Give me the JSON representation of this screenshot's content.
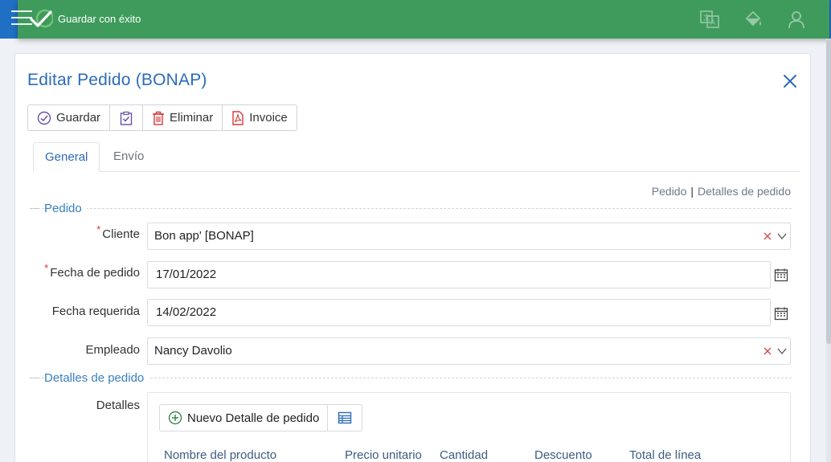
{
  "toast": {
    "message": "Guardar con éxito",
    "icons": [
      "menu-icon",
      "checkmark-icon",
      "translate-icon",
      "paint-bucket-icon",
      "user-icon"
    ]
  },
  "form": {
    "title": "Editar Pedido (BONAP)",
    "toolbar": {
      "save_label": "Guardar",
      "delete_label": "Eliminar",
      "invoice_label": "Invoice"
    },
    "tabs": [
      {
        "label": "General",
        "active": true
      },
      {
        "label": "Envío",
        "active": false
      }
    ],
    "links": {
      "order": "Pedido",
      "separator": "|",
      "details": "Detalles de pedido"
    },
    "sections": {
      "order": "Pedido",
      "details": "Detalles de pedido"
    },
    "fields": {
      "client_label": "Cliente",
      "client_value": "Bon app' [BONAP]",
      "order_date_label": "Fecha de pedido",
      "order_date_value": "17/01/2022",
      "required_date_label": "Fecha requerida",
      "required_date_value": "14/02/2022",
      "employee_label": "Empleado",
      "employee_value": "Nancy Davolio",
      "details_label": "Detalles",
      "required_marker": "*"
    },
    "details_grid": {
      "new_button_label": "Nuevo Detalle de pedido",
      "columns": [
        "Nombre del producto",
        "Precio unitario",
        "Cantidad",
        "Descuento",
        "Total de línea"
      ]
    }
  },
  "colors": {
    "header_blue": "#1f6fc5",
    "toast_green": "#3e9b5c",
    "title_blue": "#2b6bb8",
    "required_red": "#d9342b"
  }
}
